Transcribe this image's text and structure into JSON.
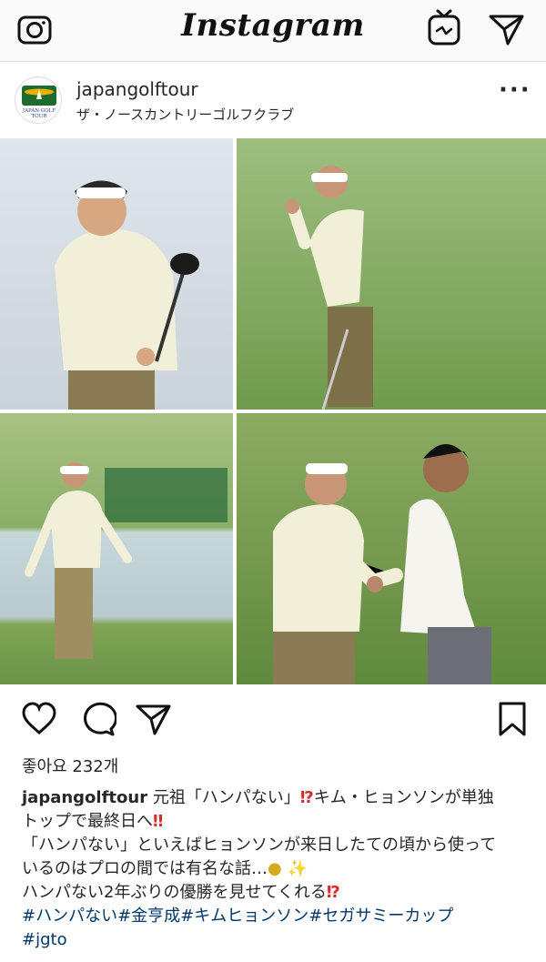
{
  "app": {
    "title": "Instagram",
    "icons": [
      "camera-icon",
      "igtv-icon",
      "direct-message-icon"
    ]
  },
  "post": {
    "username": "japangolftour",
    "location": "ザ・ノースカントリーゴルフクラブ",
    "avatar_text": "JAPAN GOLF TOUR",
    "photo_count": 4,
    "likes": "좋아요 232개",
    "caption": {
      "username": "japangolftour",
      "line1": "元祖「ハンパない」",
      "line1b": "キム・ヒョンソンが単独",
      "line2": "トップで最終日へ",
      "line3": "「ハンパない」といえばヒョンソンが来日したての頃から使って",
      "line4": "いるのはプロの間では有名な話…",
      "line5": "ハンパない2年ぶりの優勝を見せてくれる",
      "hashtags1": "#ハンパない#金亨成#キムヒョンソン#セガサミーカップ",
      "hashtags2": "#jgto"
    }
  },
  "colors": {
    "accent_link": "#00376b",
    "text": "#262626",
    "divider": "#dbdbdb"
  }
}
